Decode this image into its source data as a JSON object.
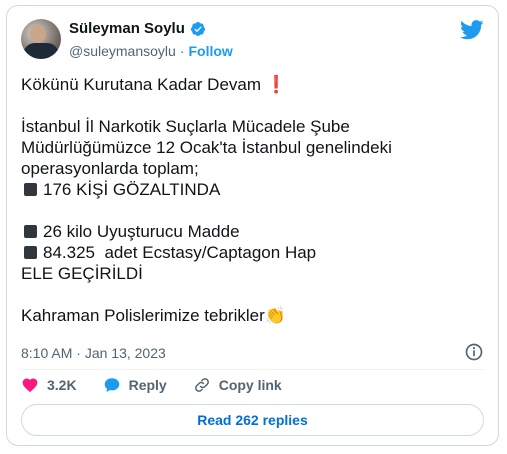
{
  "author": {
    "name": "Süleyman Soylu",
    "handle": "@suleymansoylu",
    "separator": "·",
    "follow_label": "Follow"
  },
  "tweet": {
    "lines": [
      "Kökünü Kurutana Kadar Devam",
      "",
      "İstanbul İl Narkotik Suçlarla Mücadele Şube",
      "Müdürlüğümüzce 12 Ocak'ta İstanbul genelindeki",
      "operasyonlarda toplam;",
      "176 KİŞİ GÖZALTINDA",
      "",
      "26 kilo Uyuşturucu Madde",
      "84.325  adet Ecstasy/Captagon Hap",
      "ELE GEÇİRİLDİ",
      "",
      "Kahraman Polislerimize tebrikler"
    ],
    "exclamation_emoji": "❗",
    "clap_emoji": "👏"
  },
  "meta": {
    "time": "8:10 AM",
    "separator": "·",
    "date": "Jan 13, 2023"
  },
  "actions": {
    "likes": "3.2K",
    "reply_label": "Reply",
    "copy_link_label": "Copy link"
  },
  "replies_button": "Read 262 replies",
  "colors": {
    "accent": "#1d9bf0",
    "like": "#f91880",
    "link": "#006fd6",
    "secondary_text": "#536471",
    "border": "#cfd9de"
  },
  "icons": [
    "verified-badge-icon",
    "twitter-bird-icon",
    "info-icon",
    "heart-icon",
    "reply-bubble-icon",
    "link-icon"
  ]
}
